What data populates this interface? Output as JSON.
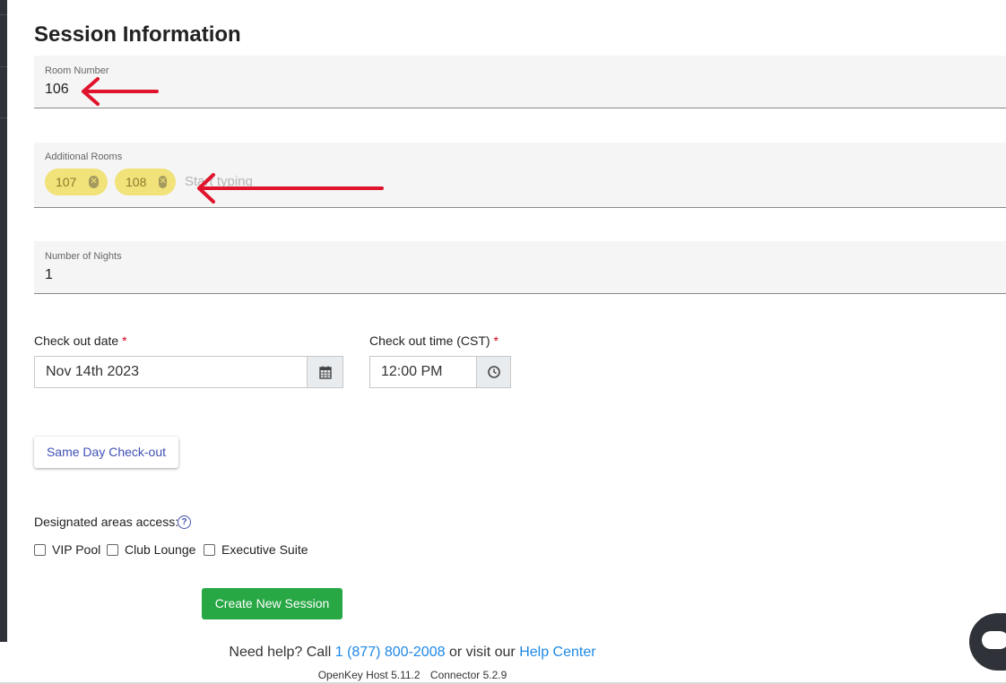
{
  "page": {
    "title": "Session Information"
  },
  "room_number": {
    "label": "Room Number",
    "value": "106"
  },
  "additional_rooms": {
    "label": "Additional Rooms",
    "chips": [
      "107",
      "108"
    ],
    "placeholder": "Start typing"
  },
  "nights": {
    "label": "Number of Nights",
    "value": "1"
  },
  "checkout_date": {
    "label": "Check out date",
    "required_mark": "*",
    "value": "Nov 14th 2023"
  },
  "checkout_time": {
    "label": "Check out time (CST)",
    "required_mark": "*",
    "value": "12:00 PM"
  },
  "same_day_button": "Same Day Check-out",
  "areas": {
    "label": "Designated areas access:",
    "options": [
      "VIP Pool",
      "Club Lounge",
      "Executive Suite"
    ]
  },
  "create_button": "Create New Session",
  "footer": {
    "help_prefix": "Need help? Call",
    "phone": "1 (877) 800-2008",
    "help_mid": "or visit our",
    "help_link": "Help Center",
    "host_version": "OpenKey Host 5.11.2",
    "connector_version": "Connector 5.2.9"
  },
  "colors": {
    "annotation_arrow": "#e0142c",
    "chip_highlight": "#f2e27a",
    "primary_button": "#28a745",
    "link": "#1e88e5",
    "required": "#d0021b"
  },
  "icons": [
    "calendar-icon",
    "clock-icon",
    "remove-chip-icon",
    "help-icon",
    "chat-icon",
    "annotation-arrow-icon"
  ]
}
